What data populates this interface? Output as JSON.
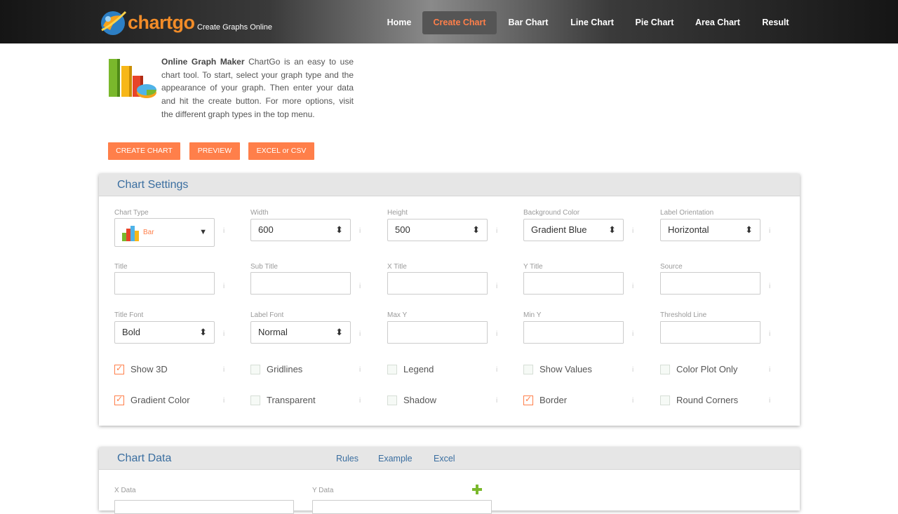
{
  "header": {
    "brand": "chartgo",
    "tagline": "Create Graphs Online",
    "nav": [
      "Home",
      "Create Chart",
      "Bar Chart",
      "Line Chart",
      "Pie Chart",
      "Area Chart",
      "Result"
    ],
    "active_nav": "Create Chart"
  },
  "intro": {
    "bold": "Online Graph Maker",
    "text": " ChartGo is an easy to use chart tool. To start, select your graph type and the appearance of your graph. Then enter your data and hit the create button. For more options, visit the different graph types in the top menu."
  },
  "actions": {
    "create": "CREATE CHART",
    "preview": "PREVIEW",
    "excel": "EXCEL or CSV"
  },
  "settings": {
    "title": "Chart Settings",
    "chart_type_label": "Chart Type",
    "chart_type_value": "Bar",
    "width_label": "Width",
    "width_value": "600",
    "height_label": "Height",
    "height_value": "500",
    "bg_label": "Background Color",
    "bg_value": "Gradient Blue",
    "orient_label": "Label Orientation",
    "orient_value": "Horizontal",
    "title_label": "Title",
    "subtitle_label": "Sub Title",
    "xtitle_label": "X Title",
    "ytitle_label": "Y Title",
    "source_label": "Source",
    "titlefont_label": "Title Font",
    "titlefont_value": "Bold",
    "labelfont_label": "Label Font",
    "labelfont_value": "Normal",
    "maxy_label": "Max Y",
    "miny_label": "Min Y",
    "threshold_label": "Threshold Line",
    "info": "i",
    "checks_row1": [
      {
        "label": "Show 3D",
        "checked": true
      },
      {
        "label": "Gridlines",
        "checked": false
      },
      {
        "label": "Legend",
        "checked": false
      },
      {
        "label": "Show Values",
        "checked": false
      },
      {
        "label": "Color Plot Only",
        "checked": false
      }
    ],
    "checks_row2": [
      {
        "label": "Gradient Color",
        "checked": true
      },
      {
        "label": "Transparent",
        "checked": false
      },
      {
        "label": "Shadow",
        "checked": false
      },
      {
        "label": "Border",
        "checked": true
      },
      {
        "label": "Round Corners",
        "checked": false
      }
    ]
  },
  "data_panel": {
    "title": "Chart Data",
    "links": [
      "Rules",
      "Example",
      "Excel"
    ],
    "xdata_label": "X Data",
    "ydata_label": "Y Data"
  },
  "colors": {
    "accent": "#ff7f4a",
    "panel_title": "#3a6ea0"
  }
}
